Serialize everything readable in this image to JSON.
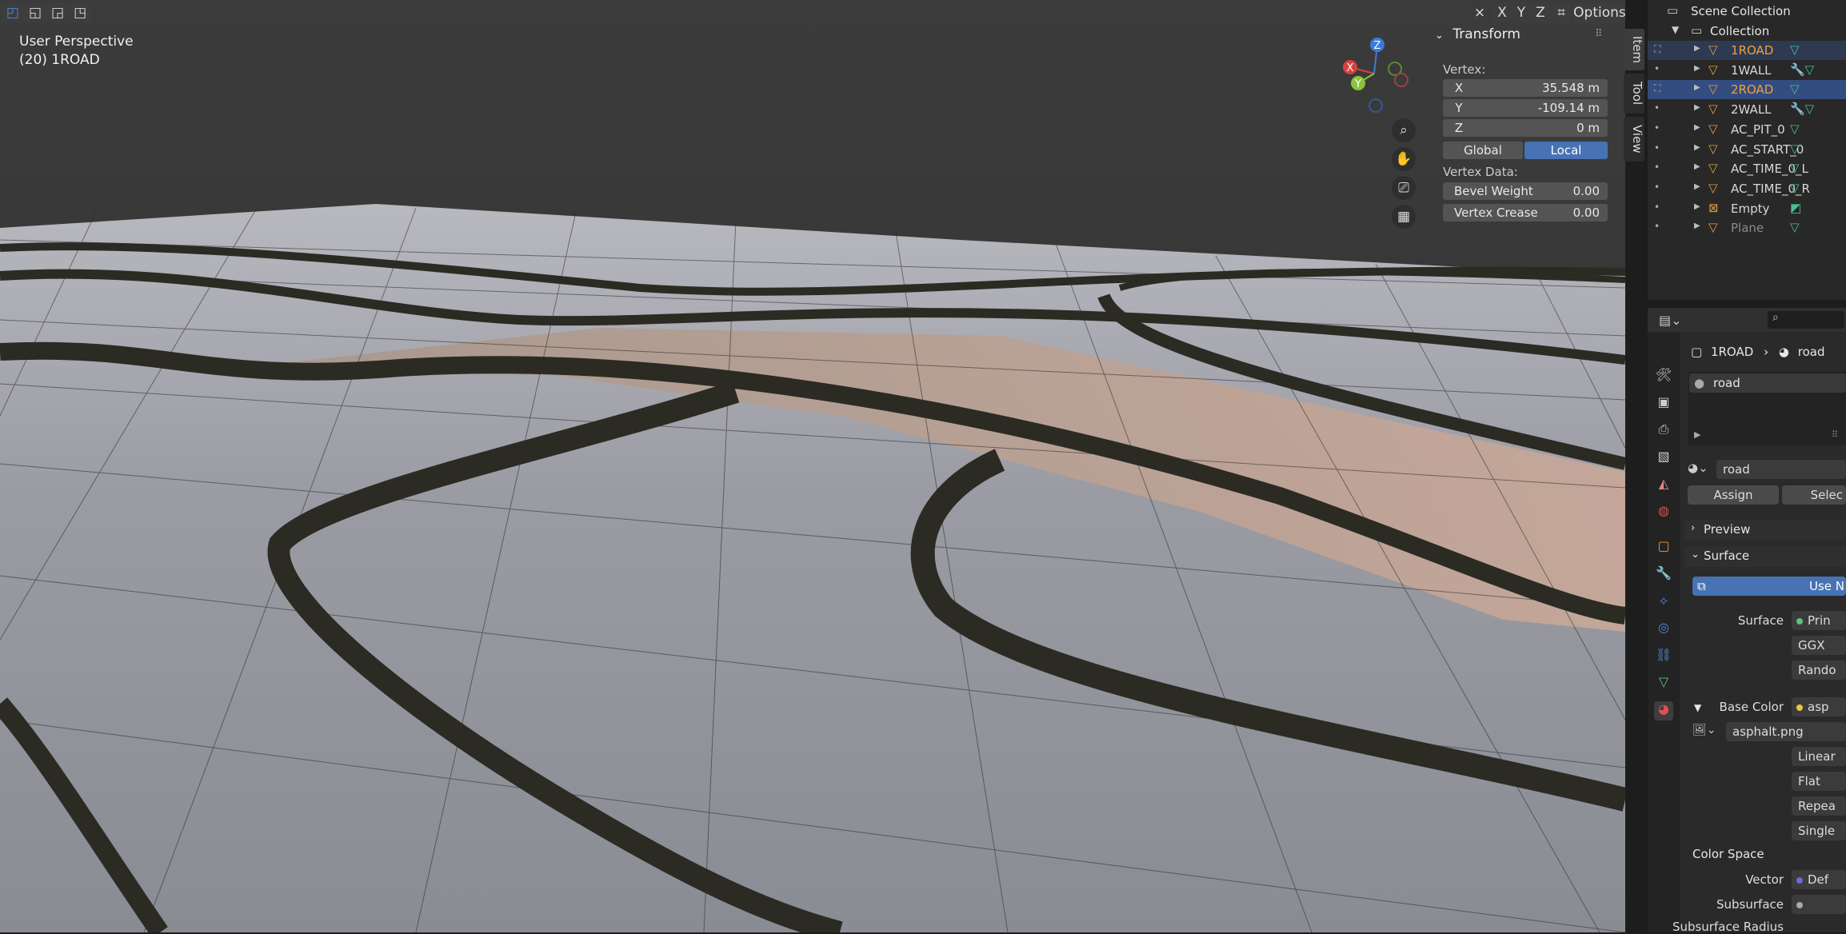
{
  "viewport": {
    "mode_line1": "User Perspective",
    "mode_line2": "(20) 1ROAD",
    "options_label": "Options",
    "axis_x": "X",
    "axis_y": "Y",
    "axis_z": "Z",
    "gizmo": {
      "x": "X",
      "y": "Y",
      "z": "Z"
    }
  },
  "n_panel": {
    "title": "Transform",
    "vertex_label": "Vertex:",
    "fields": [
      {
        "key": "X",
        "value": "35.548 m"
      },
      {
        "key": "Y",
        "value": "-109.14 m"
      },
      {
        "key": "Z",
        "value": "0 m"
      }
    ],
    "global_label": "Global",
    "local_label": "Local",
    "vertex_data_label": "Vertex Data:",
    "bevel_weight_label": "Bevel Weight",
    "bevel_weight_value": "0.00",
    "vertex_crease_label": "Vertex Crease",
    "vertex_crease_value": "0.00",
    "tabs": [
      "Item",
      "Tool",
      "View"
    ]
  },
  "outliner": {
    "scene_collection": "Scene Collection",
    "collection": "Collection",
    "items": [
      {
        "name": "1ROAD",
        "color": "#f0a040",
        "selected": true
      },
      {
        "name": "1WALL",
        "color": "#d8d8d8",
        "selected": false
      },
      {
        "name": "2ROAD",
        "color": "#f0a040",
        "selected": true
      },
      {
        "name": "2WALL",
        "color": "#d8d8d8",
        "selected": false
      },
      {
        "name": "AC_PIT_0",
        "color": "#d8d8d8",
        "selected": false
      },
      {
        "name": "AC_START_0",
        "color": "#d8d8d8",
        "selected": false
      },
      {
        "name": "AC_TIME_0_L",
        "color": "#d8d8d8",
        "selected": false
      },
      {
        "name": "AC_TIME_0_R",
        "color": "#d8d8d8",
        "selected": false
      },
      {
        "name": "Empty",
        "color": "#d8d8d8",
        "selected": false
      },
      {
        "name": "Plane",
        "color": "#8a8a8a",
        "selected": false
      }
    ]
  },
  "properties": {
    "breadcrumb_object": "1ROAD",
    "breadcrumb_material": "road",
    "slot_name": "road",
    "material_name": "road",
    "assign_label": "Assign",
    "select_label": "Selec",
    "preview_label": "Preview",
    "surface_label": "Surface",
    "use_nodes_label": "Use N",
    "surface_field_label": "Surface",
    "surface_field_value": "Prin",
    "ggx_value": "GGX",
    "random_value": "Rando",
    "base_color_label": "Base Color",
    "base_color_value": "asp",
    "image_name": "asphalt.png",
    "linear_value": "Linear",
    "flat_value": "Flat",
    "repeat_value": "Repea",
    "single_value": "Single",
    "color_space_label": "Color Space",
    "vector_label": "Vector",
    "vector_value": "Def",
    "subsurface_label": "Subsurface",
    "subsurface_radius_label": "Subsurface Radius"
  }
}
